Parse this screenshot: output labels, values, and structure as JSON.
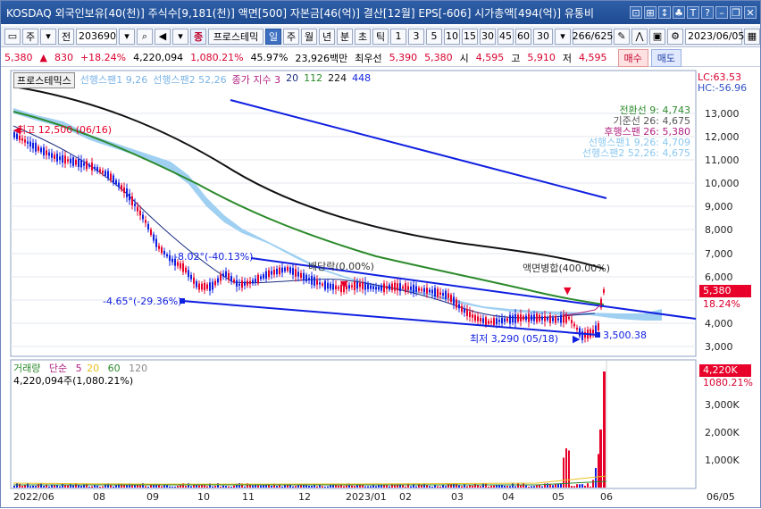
{
  "title": "KOSDAQ 외국인보유[40(천)] 주식수[9,181(천)] 액면[500] 자본금[46(억)] 결산[12월] EPS[-606] 시가총액[494(억)] 유통비",
  "title_icons": [
    "window-icon",
    "pin-icon",
    "close-small-icon",
    "sort-icon",
    "text-icon",
    "help-icon",
    "minimize-icon",
    "restore-icon",
    "close-icon"
  ],
  "toolbar": {
    "market_type": "주",
    "prev_label": "전",
    "code": "203690",
    "program_label": "종",
    "program_name": "프로스테믹",
    "periods": [
      "일",
      "주",
      "월",
      "년",
      "분",
      "초",
      "틱"
    ],
    "minutes": [
      "1",
      "3",
      "5",
      "10",
      "15",
      "30",
      "45",
      "60"
    ],
    "interval": "30",
    "count": "266/625",
    "date": "2023/06/05"
  },
  "quote": {
    "price": "5,380",
    "arrow": "▲",
    "change": "830",
    "rate": "+18.24%",
    "volume": "4,220,094",
    "vol_rate": "1,080.21%",
    "turnover": "45.97%",
    "amount": "23,926백만",
    "holder_label": "최우선",
    "ask": "5,390",
    "bid": "5,380",
    "open_label": "시",
    "open": "4,595",
    "high_label": "고",
    "high": "5,910",
    "low_label": "저",
    "low": "4,595",
    "buy_label": "매수",
    "sell_label": "매도"
  },
  "legend": {
    "name": "프로스테믹스",
    "span1": "선행스팬1 9,26",
    "span2": "선행스팬2 52,26",
    "close_index": "종가 지수 3",
    "ma": [
      "20",
      "112",
      "224",
      "448"
    ]
  },
  "ichimoku": {
    "turn": "전환선 9: 4,743",
    "base": "기준선 26: 4,675",
    "lag": "후행스팬 26: 5,380",
    "span1": "선행스팬1 9,26: 4,709",
    "span2": "선행스팬2 52,26: 4,675"
  },
  "lc": "LC:63.53",
  "hc": "HC:-56.96",
  "price_box": "5,380",
  "price_rate": "18.24%",
  "y_ticks": [
    "13,000",
    "12,000",
    "11,000",
    "10,000",
    "9,000",
    "8,000",
    "7,000",
    "6,000",
    "5,000",
    "4,000",
    "3,000"
  ],
  "annotations": {
    "high": "최고 12,500 (06/16)",
    "angle1": "-8.02°(-40.13%)",
    "dividend": "배당락(0.00%)",
    "angle2": "-4.65°(-29.36%)",
    "merge": "액면병합(400.00%)",
    "low": "최저 3,290 (05/18)",
    "trend_val": "3,500.38"
  },
  "volume": {
    "label": "거래량",
    "type": "단순",
    "ma": [
      "5",
      "20",
      "60",
      "120"
    ],
    "sub": "4,220,094주(1,080.21%)",
    "box": "4,220K",
    "rate": "1080.21%",
    "ticks": [
      "3,000K",
      "2,000K",
      "1,000K"
    ]
  },
  "x_ticks": [
    "2022/06",
    "08",
    "09",
    "10",
    "11",
    "12",
    "2023/01",
    "02",
    "03",
    "04",
    "05",
    "06",
    "06/05"
  ],
  "colors": {
    "red": "#e8002a",
    "blue": "#1020e0",
    "cloud": "#8cc8f0",
    "ma_green": "#2c8a2c",
    "ma_black": "#111111",
    "title_bg": "#2e5fa8"
  }
}
